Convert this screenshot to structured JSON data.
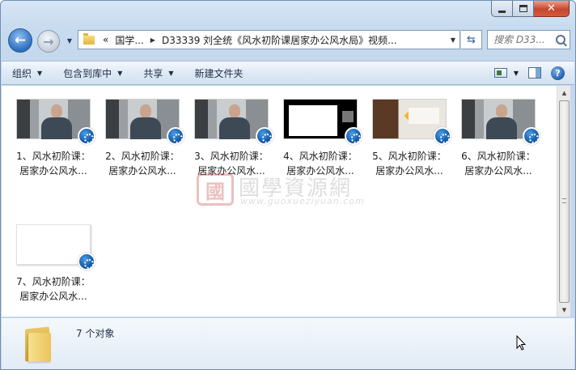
{
  "address": {
    "overflow": "«",
    "parts": [
      "国学...",
      "D33339 刘全统《风水初阶课居家办公风水局》视频..."
    ]
  },
  "search": {
    "placeholder": "搜索 D33..."
  },
  "toolbar": {
    "organize": "组织",
    "include_library": "包含到库中",
    "share": "共享",
    "new_folder": "新建文件夹"
  },
  "files": [
    {
      "line1": "1、风水初阶课：",
      "line2": "居家办公风水...",
      "thumb": "person"
    },
    {
      "line1": "2、风水初阶课：",
      "line2": "居家办公风水...",
      "thumb": "person"
    },
    {
      "line1": "3、风水初阶课：",
      "line2": "居家办公风水...",
      "thumb": "person"
    },
    {
      "line1": "4、风水初阶课：",
      "line2": "居家办公风水...",
      "thumb": "black"
    },
    {
      "line1": "5、风水初阶课：",
      "line2": "居家办公风水...",
      "thumb": "room"
    },
    {
      "line1": "6、风水初阶课：",
      "line2": "居家办公风水...",
      "thumb": "person"
    },
    {
      "line1": "7、风水初阶课：",
      "line2": "居家办公风水...",
      "thumb": "white"
    }
  ],
  "details": {
    "count": "7 个对象"
  },
  "watermark": {
    "seal": "國",
    "text": "國學資源網",
    "url": "www.guoxueziyuan.com"
  },
  "icons": {
    "back": "back-arrow-icon",
    "forward": "forward-arrow-icon",
    "refresh": "refresh-icon",
    "search": "search-icon",
    "help": "help-icon",
    "video": "video-badge-icon"
  }
}
